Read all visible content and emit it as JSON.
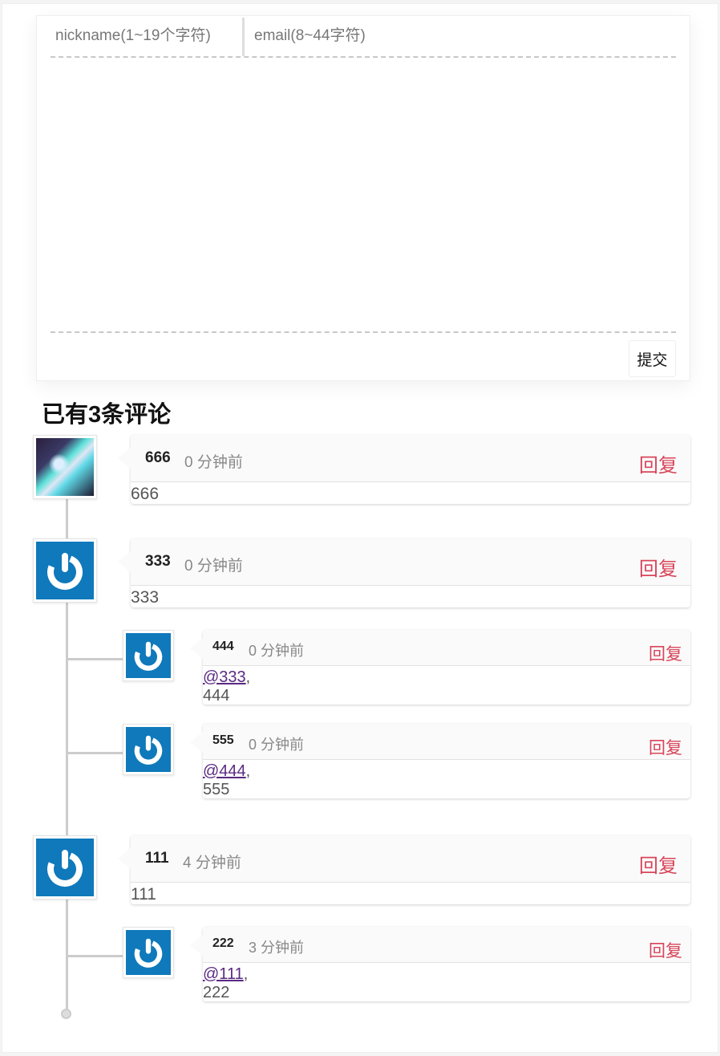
{
  "form": {
    "nickname_placeholder": "nickname(1~19个字符)",
    "email_placeholder": "email(8~44字符)",
    "submit_label": "提交"
  },
  "comments_title": "已有3条评论",
  "comments": [
    {
      "name": "666",
      "time": "0 分钟前",
      "reply": "回复",
      "text": "666"
    },
    {
      "name": "333",
      "time": "0 分钟前",
      "reply": "回复",
      "text": "333"
    },
    {
      "name": "444",
      "time": "0 分钟前",
      "reply": "回复",
      "mention": "@333",
      "sep": ",",
      "text": "444"
    },
    {
      "name": "555",
      "time": "0 分钟前",
      "reply": "回复",
      "mention": "@444",
      "sep": ",",
      "text": "555"
    },
    {
      "name": "111",
      "time": "4 分钟前",
      "reply": "回复",
      "text": "111"
    },
    {
      "name": "222",
      "time": "3 分钟前",
      "reply": "回复",
      "mention": "@111",
      "sep": ",",
      "text": "222"
    }
  ],
  "colors": {
    "reply": "#d8455a",
    "avatar_bg": "#0f79bb",
    "mention": "#5a2a82"
  },
  "icons": {
    "default_avatar": "power-icon"
  }
}
